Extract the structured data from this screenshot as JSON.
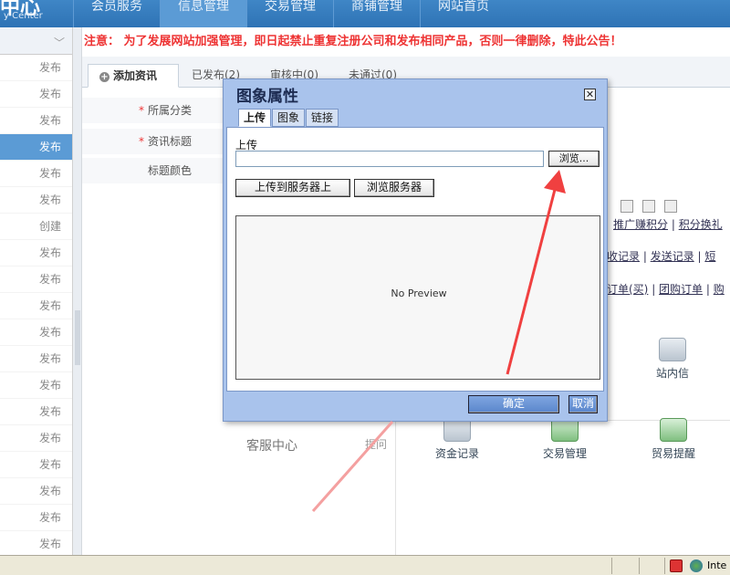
{
  "header": {
    "logo_title": "中心",
    "logo_subtitle": "y Center",
    "nav": [
      "会员服务",
      "信息管理",
      "交易管理",
      "商铺管理",
      "网站首页"
    ],
    "active_nav": 1
  },
  "sidebar": {
    "items": [
      "发布",
      "发布",
      "发布",
      "发布",
      "发布",
      "发布",
      "创建",
      "发布",
      "发布",
      "发布",
      "发布",
      "发布",
      "发布",
      "发布",
      "发布",
      "发布",
      "发布",
      "发布",
      "发布"
    ],
    "active_index": 3
  },
  "notice": "注意： 为了发展网站加强管理，即日起禁止重复注册公司和发布相同产品，否则一律删除，特此公告！",
  "tabs": {
    "add": "添加资讯",
    "published": "已发布(2)",
    "reviewing": "审核中(0)",
    "rejected": "未通过(0)"
  },
  "form": {
    "category": "所属分类",
    "title": "资讯标题",
    "title_color": "标题颜色",
    "required_mark": "*"
  },
  "background_links": {
    "row1": [
      "推广赚积分",
      "积分换礼"
    ],
    "row2": [
      "收记录",
      "发送记录",
      "短"
    ],
    "row3": [
      "订单(买)",
      "团购订单",
      "购"
    ]
  },
  "lower": {
    "service_center": "客服中心",
    "service_link": "提问",
    "features": [
      "站内信",
      "资金记录",
      "交易管理",
      "贸易提醒"
    ]
  },
  "dialog": {
    "title": "图象属性",
    "close_glyph": "✕",
    "tabs": [
      "上传",
      "图象",
      "链接"
    ],
    "active_tab": 0,
    "upload_label": "上传",
    "file_value": "",
    "browse_label": "浏览...",
    "upload_to_server": "上传到服务器上",
    "browse_server": "浏览服务器",
    "preview_text": "No Preview",
    "ok_label": "确定",
    "cancel_label": "取消"
  },
  "statusbar": {
    "zone": "Inte"
  },
  "colors": {
    "accent": "#2e73b5",
    "dialog_bg": "#a9c3ec",
    "notice": "#e33333",
    "arrow": "#f04040"
  }
}
